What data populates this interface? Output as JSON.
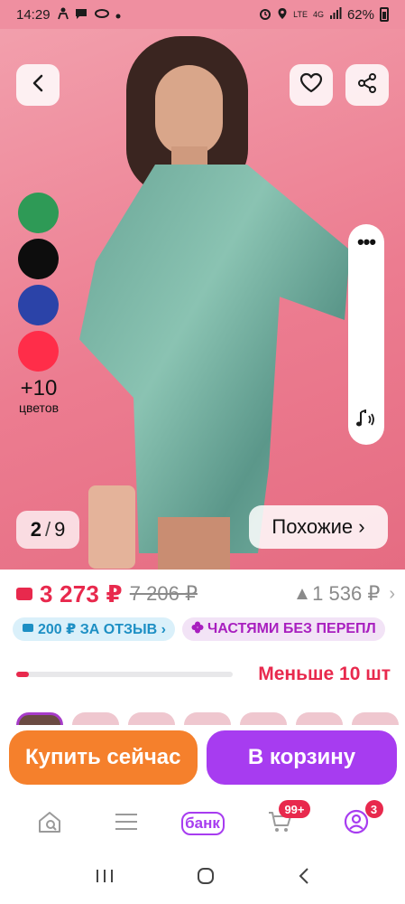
{
  "status_bar": {
    "time": "14:29",
    "network": "LTE",
    "network_gen": "4G",
    "battery": "62%",
    "icons": [
      "person-icon",
      "chat-icon",
      "loop-icon",
      "dot-icon",
      "alarm-icon",
      "location-icon",
      "volte-icon",
      "signal-icon",
      "battery-icon"
    ]
  },
  "hero": {
    "image_index": "2",
    "image_count": "9",
    "similar_label": "Похожие ›",
    "swatches": [
      {
        "name": "green",
        "color": "#2e9a56"
      },
      {
        "name": "black",
        "color": "#0d0d0d"
      },
      {
        "name": "blue",
        "color": "#2b43a8"
      },
      {
        "name": "red",
        "color": "#ff2d49"
      }
    ],
    "more_colors_count": "+10",
    "more_colors_word": "цветов"
  },
  "product": {
    "price": "3 273 ₽",
    "old_price": "7 206 ₽",
    "price_drop": "1 536 ₽",
    "promo_review": "200 ₽ ЗА ОТЗЫВ ›",
    "promo_parts": "ЧАСТЯМИ БЕЗ ПЕРЕПЛ",
    "stock_text": "Меньше 10 шт",
    "stock_level": 0.06
  },
  "actions": {
    "buy_now": "Купить сейчас",
    "add_to_cart": "В корзину"
  },
  "tabbar": {
    "bank_label": "банк",
    "cart_badge": "99+",
    "profile_badge": "3"
  },
  "colors": {
    "accent_red": "#e8294d",
    "buy_orange": "#f5802c",
    "cart_purple": "#a73cf0",
    "hero_pink": "#ef8fa0"
  }
}
